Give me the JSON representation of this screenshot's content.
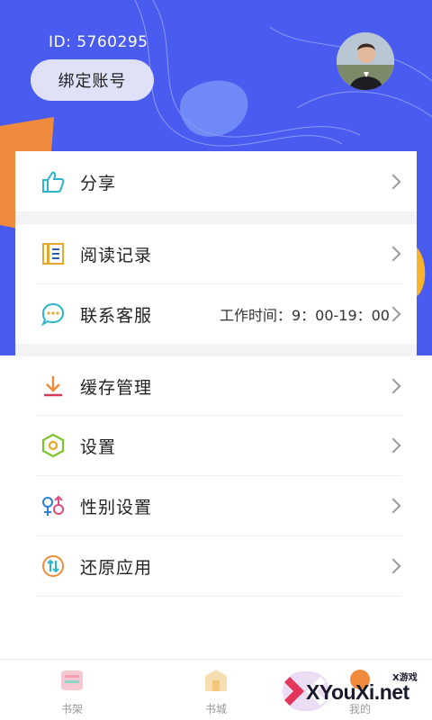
{
  "header": {
    "user_id": "ID: 5760295",
    "bind_button": "绑定账号"
  },
  "menu": {
    "share": "分享",
    "history": "阅读记录",
    "support": "联系客服",
    "support_hours": "工作时间：9：00-19：00",
    "cache": "缓存管理",
    "settings": "设置",
    "gender": "性别设置",
    "restore": "还原应用"
  },
  "tabs": {
    "shelf": "书架",
    "store": "书城",
    "mine": "我的"
  },
  "watermark": {
    "brand": "XYouXi.net",
    "tag": "X游戏"
  },
  "colors": {
    "header_bg": "#4a5cf0",
    "accent_orange": "#f08a3c",
    "accent_teal": "#2bb5c9",
    "accent_green": "#7cc32a"
  },
  "icons": {
    "share": "thumbs-up-icon",
    "history": "book-list-icon",
    "support": "chat-bubble-icon",
    "cache": "download-icon",
    "settings": "hexagon-gear-icon",
    "gender": "gender-symbols-icon",
    "restore": "restore-circle-icon",
    "chevron": "chevron-right-icon"
  }
}
